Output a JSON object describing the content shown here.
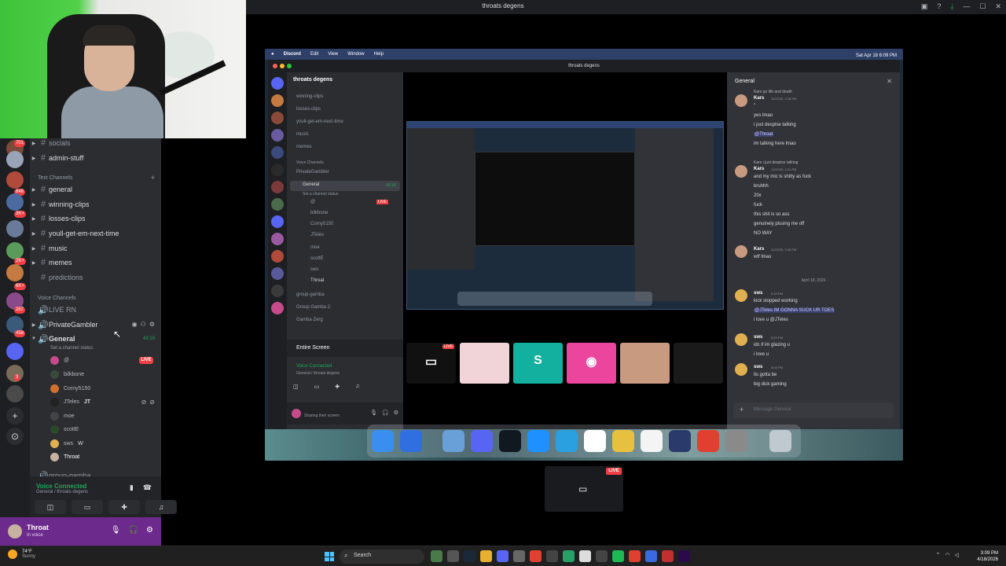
{
  "window": {
    "title": "throats degens"
  },
  "sidebar": {
    "categories": {
      "text": "Text Channels",
      "voice": "Voice Channels"
    },
    "top_items": [
      "socials",
      "admin-stuff"
    ],
    "text_channels": [
      "general",
      "winning-clips",
      "losses-clips",
      "youll-get-em-next-time",
      "music",
      "memes",
      "predictions"
    ],
    "voice_channels": [
      {
        "name": "LIVE RN",
        "icon": "speaker-icon"
      },
      {
        "name": "PrivateGambler"
      },
      {
        "name": "General",
        "timer": "43:19",
        "status": "Set a channel status"
      }
    ],
    "voice_users": [
      "@",
      "bilkbone",
      "Corny5150",
      "JTeles",
      "moe",
      "scottE",
      "sws",
      "Throat"
    ],
    "voice_user_extras": {
      "jteles_tag": "JT",
      "sws_tag": "W"
    },
    "live_label": "LIVE",
    "cutoff_item": "group-gamba",
    "server_badges": [
      "701",
      "646",
      "3K+",
      "2K+",
      "6K+",
      "267",
      "458",
      "3"
    ]
  },
  "voice_panel": {
    "status": "Voice Connected",
    "location": "General / throats degens"
  },
  "user_panel": {
    "name": "Throat",
    "status": "In voice"
  },
  "shared_screen": {
    "menu_bar": [
      "Discord",
      "Edit",
      "View",
      "Window",
      "Help"
    ],
    "clock": "Sat Apr 18 6:09 PM",
    "app_title": "throats degens",
    "server_name": "throats degens",
    "channels": [
      "winning-clips",
      "losses-clips",
      "youll-get-em-next-time",
      "music",
      "memes"
    ],
    "voice_category": "Voice Channels",
    "voice_channels": [
      "PrivateGambler",
      "General"
    ],
    "general_status": "Set a channel status",
    "general_timer": "43:18",
    "voice_users": [
      "@",
      "bilkbone",
      "Corny5150",
      "JTeles",
      "moe",
      "scottE",
      "sws",
      "Throat"
    ],
    "more_channels": [
      "group-gamba",
      "Group Gamba 2",
      "Gamba Zerg"
    ],
    "entire_screen": "Entire Screen",
    "voice_connected": "Voice Connected",
    "voice_location": "General / throats degens",
    "sharing": "Sharing their screen",
    "chat_header": "General",
    "messages": [
      {
        "reply": "Kars go life and death",
        "name": "Kars",
        "time": "11/22/25, 2:18 PM",
        "lines": [
          "\"",
          "yes lmao",
          "i just despise talking",
          "@Throat",
          "im talking here lmao"
        ]
      },
      {
        "reply": "Kars i just despise talking",
        "name": "Kars",
        "time": "11/22/25, 2:21 PM",
        "lines": [
          "and my mic is shitty as fuck",
          "bruhhh",
          "20x",
          "fuck",
          "this shit is so ass",
          "genuinely pissing me off",
          "NO WAY"
        ]
      },
      {
        "name": "Kars",
        "time": "11/22/25, 2:43 PM",
        "lines": [
          "wtf lmao"
        ]
      },
      {
        "date": "April 18, 2026"
      },
      {
        "name": "sws",
        "time": "5:45 PM",
        "lines": [
          "kick stopped working",
          "@JTeles IM GONNA SUCK UR TOES",
          "i love u @JTeles"
        ]
      },
      {
        "name": "sws",
        "time": "5:53 PM",
        "lines": [
          "idc if im glazing u",
          "i love u"
        ]
      },
      {
        "name": "sws",
        "time": "6:03 PM",
        "lines": [
          "its gotta be",
          "big dick gaming"
        ]
      }
    ],
    "chat_placeholder": "Message General",
    "live_label": "LIVE"
  },
  "thumbnail": {
    "live": "LIVE"
  },
  "taskbar": {
    "weather_temp": "74°F",
    "weather_desc": "Sunny",
    "search": "Search",
    "time": "3:09 PM",
    "date": "4/18/2026"
  },
  "colors": {
    "accent": "#5865f2",
    "online": "#23a55a",
    "live": "#f23f43",
    "user_panel": "#6c2a8c"
  }
}
